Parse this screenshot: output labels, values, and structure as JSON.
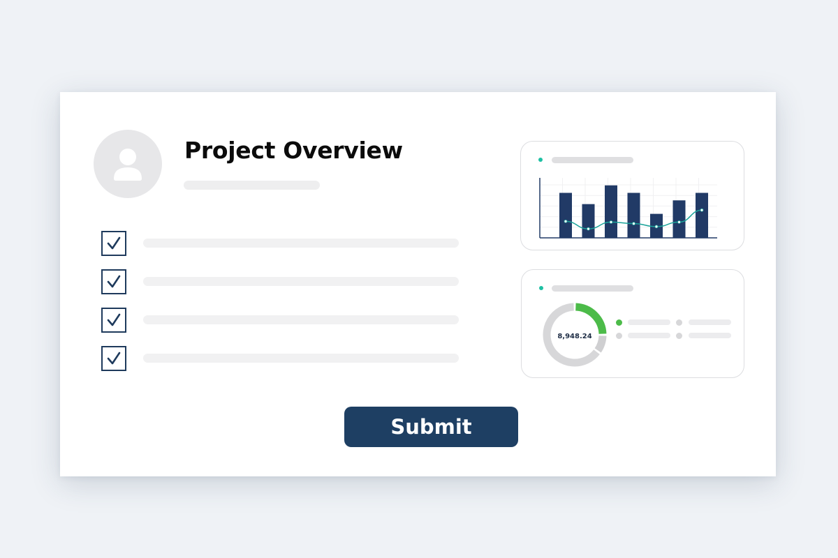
{
  "header": {
    "title": "Project Overview"
  },
  "checklist": {
    "items": [
      {
        "checked": true
      },
      {
        "checked": true
      },
      {
        "checked": true
      },
      {
        "checked": true
      }
    ]
  },
  "actions": {
    "submit_label": "Submit"
  },
  "icons": {
    "avatar": "user-icon",
    "check": "check-icon",
    "legend_dot": "dot-icon"
  },
  "colors": {
    "accent": "#1e3f63",
    "bar": "#213a66",
    "trend": "#1aa39a",
    "donut_green": "#4cbb49",
    "donut_gray": "#d7d7d9",
    "teal_dot": "#1ec0a3"
  },
  "chart_data": [
    {
      "type": "bar",
      "values": [
        6,
        4.5,
        7,
        6,
        3.2,
        5,
        6
      ],
      "trend": [
        2.2,
        1.2,
        2.1,
        1.9,
        1.5,
        2.1,
        3.7
      ],
      "grid": true
    },
    {
      "type": "pie",
      "center_label": "8,948.24",
      "values": [
        25,
        10,
        65
      ]
    }
  ]
}
